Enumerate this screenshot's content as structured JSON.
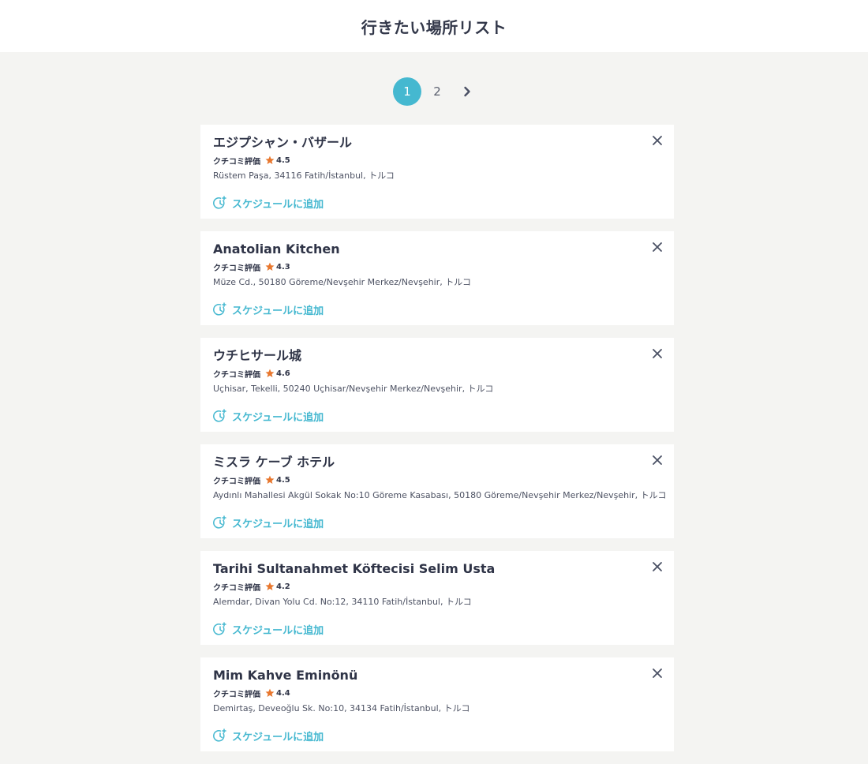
{
  "header": {
    "title": "行きたい場所リスト"
  },
  "pagination": {
    "pages": [
      "1",
      "2"
    ],
    "current": "1",
    "next_icon": "chevron-right-icon"
  },
  "colors": {
    "accent": "#45b8d0",
    "star": "#e8772e",
    "text": "#33384a"
  },
  "rating_label": "クチコミ評価",
  "schedule_label": "スケジュールに追加",
  "places": [
    {
      "name": "エジプシャン・バザール",
      "rating": "4.5",
      "address": "Rüstem Paşa, 34116 Fatih/İstanbul, トルコ"
    },
    {
      "name": "Anatolian Kitchen",
      "rating": "4.3",
      "address": "Müze Cd., 50180 Göreme/Nevşehir Merkez/Nevşehir, トルコ"
    },
    {
      "name": "ウチヒサール城",
      "rating": "4.6",
      "address": "Uçhisar, Tekelli, 50240 Uçhisar/Nevşehir Merkez/Nevşehir, トルコ"
    },
    {
      "name": "ミスラ ケーブ ホテル",
      "rating": "4.5",
      "address": "Aydınlı Mahallesi Akgül Sokak No:10 Göreme Kasabası, 50180 Göreme/Nevşehir Merkez/Nevşehir, トルコ"
    },
    {
      "name": "Tarihi Sultanahmet Köftecisi Selim Usta",
      "rating": "4.2",
      "address": "Alemdar, Divan Yolu Cd. No:12, 34110 Fatih/İstanbul, トルコ"
    },
    {
      "name": "Mim Kahve Eminönü",
      "rating": "4.4",
      "address": "Demirtaş, Deveoğlu Sk. No:10, 34134 Fatih/İstanbul, トルコ"
    }
  ]
}
